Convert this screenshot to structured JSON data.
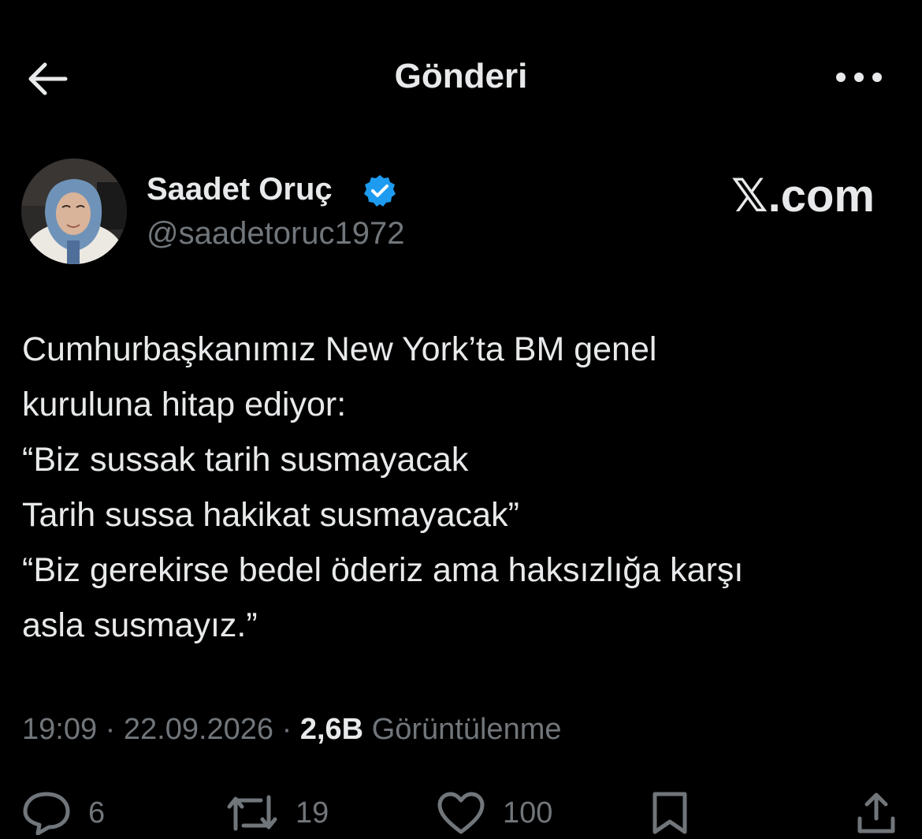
{
  "header": {
    "title": "Gönderi",
    "back_icon": "arrow-left-icon",
    "more_icon": "more-horizontal-icon"
  },
  "author": {
    "name": "Saadet Oruç",
    "handle": "@saadetoruc1972",
    "verified": true,
    "verified_color": "#1d9bf0"
  },
  "brand": {
    "x_mark": "𝕏",
    "text": ".com"
  },
  "tweet": {
    "lines": [
      "Cumhurbaşkanımız New York’ta BM genel",
      "kuruluna hitap ediyor:",
      "“Biz sussak tarih susmayacak",
      "Tarih sussa hakikat susmayacak”",
      "“Biz gerekirse bedel öderiz ama haksızlığa karşı",
      "asla susmayız.”"
    ]
  },
  "meta": {
    "time": "19:09",
    "date": "22.09.2026",
    "views": "2,6B",
    "views_label": "Görüntülenme",
    "separator": " · "
  },
  "actions": {
    "reply_count": "6",
    "repost_count": "19",
    "like_count": "100"
  },
  "colors": {
    "background": "#000000",
    "text": "#e7e9ea",
    "muted": "#71767b",
    "accent": "#1d9bf0"
  }
}
